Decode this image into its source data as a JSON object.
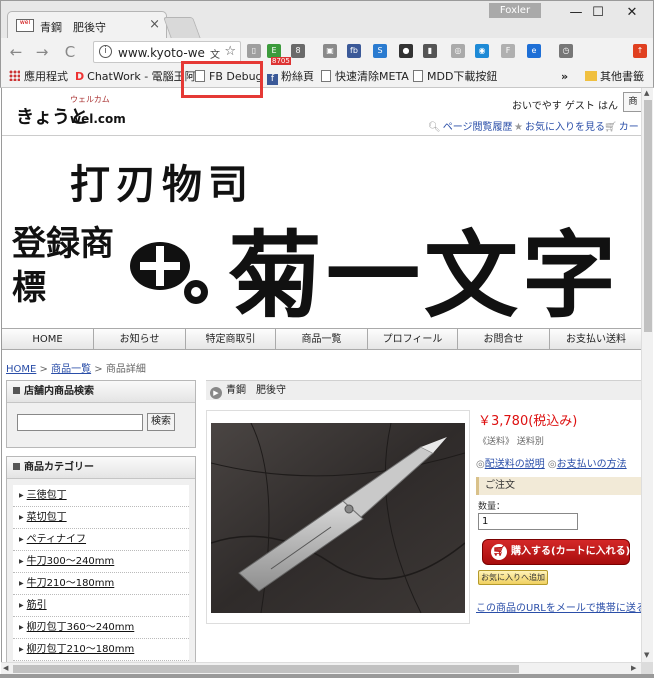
{
  "browser": {
    "tab": {
      "favicon_text": "wel",
      "title": "青鋼　肥後守",
      "close": "×"
    },
    "profile": "Foxler",
    "window_controls": {
      "minimize": "—",
      "maximize": "☐",
      "close": "✕"
    },
    "nav": {
      "back": "←",
      "forward": "→",
      "reload": "C"
    },
    "omnibox": {
      "info": "i",
      "url": "www.kyoto-we",
      "translate": "文",
      "star": "☆"
    },
    "ext_badge": "8705",
    "extensions": [
      {
        "name": "page-ext-icon",
        "text": "▯",
        "color": "#9e9e9e"
      },
      {
        "name": "evernote-ext-icon",
        "text": "E",
        "color": "#3c9b3c"
      },
      {
        "name": "badge-ext-icon",
        "text": "8",
        "color": "#6a6a6a"
      },
      {
        "name": "image-ext-icon",
        "text": "▣",
        "color": "#8a8a8a"
      },
      {
        "name": "fb-ext-icon",
        "text": "fb",
        "color": "#3b5998"
      },
      {
        "name": "s-ext-icon",
        "text": "S",
        "color": "#2a7bd0"
      },
      {
        "name": "gamepad-ext-icon",
        "text": "●",
        "color": "#333333"
      },
      {
        "name": "bookmark-ext-icon",
        "text": "▮",
        "color": "#555555"
      },
      {
        "name": "globe-ext-icon",
        "text": "◎",
        "color": "#aaaaaa"
      },
      {
        "name": "target-ext-icon",
        "text": "◉",
        "color": "#1e8ad6"
      },
      {
        "name": "f-ext-icon",
        "text": "F",
        "color": "#b0b0b0"
      },
      {
        "name": "e-ext-icon",
        "text": "e",
        "color": "#1e6fd6"
      },
      {
        "name": "clock-ext-icon",
        "text": "◷",
        "color": "#777777"
      },
      {
        "name": "menu-ext-icon",
        "text": "↑",
        "color": "#e04020"
      }
    ],
    "bookmarks": {
      "apps": "應用程式",
      "items": [
        "ChatWork - 電腦王阿",
        "FB Debug",
        "粉絲頁",
        "快速清除META",
        "MDD下載按鈕"
      ],
      "more": "»",
      "other": "其他書籤"
    }
  },
  "site": {
    "logo": {
      "main": "きょうと",
      "sub": "ウェルカム",
      "tag": "wel.com"
    },
    "greeting": "おいでやす ゲスト はん",
    "header_box": "商",
    "header_links": [
      "ページ閲覧履歴",
      "お気に入りを見る",
      "カー"
    ],
    "banner": {
      "top": "打刃物司",
      "left": "登録商標",
      "brand": "菊一文字"
    },
    "gnav": [
      "HOME",
      "お知らせ",
      "特定商取引",
      "商品一覧",
      "プロフィール",
      "お問合せ",
      "お支払い送料"
    ],
    "breadcrumb": {
      "home": "HOME",
      "sep": ">",
      "list": "商品一覧",
      "current": "商品詳細"
    },
    "search_box": {
      "title": "店舗内商品検索",
      "button": "検索",
      "value": ""
    },
    "category_box": {
      "title": "商品カテゴリー",
      "items": [
        "三徳包丁",
        "菜切包丁",
        "ペティナイフ",
        "牛刀300～240mm",
        "牛刀210～180mm",
        "筋引",
        "柳刃包丁360～240mm",
        "柳刃包丁210～180mm"
      ]
    },
    "product": {
      "title": "青鋼　肥後守",
      "price": "￥3,780(税込み)",
      "shipping": "《送料》 送料別",
      "link_shipping": "配送料の説明",
      "link_payment": "お支払いの方法",
      "order_head": "ご注文",
      "qty_label": "数量：",
      "qty_value": "1",
      "cart_button": "購入する(カートに入れる)",
      "fav_button": "お気に入りへ追加",
      "mail_link": "この商品のURLをメールで携帯に送る"
    }
  }
}
